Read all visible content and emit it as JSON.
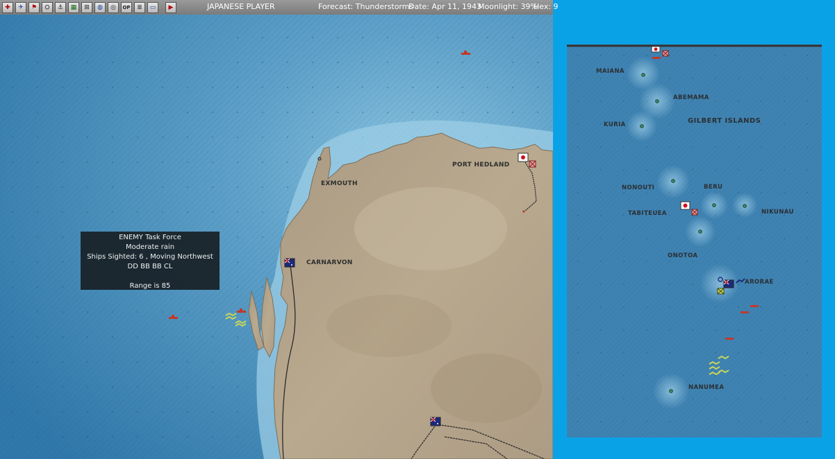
{
  "toolbar": {
    "buttons": [
      {
        "icon": "ground-unit-icon",
        "glyph": "✚"
      },
      {
        "icon": "air-unit-icon",
        "glyph": "✈"
      },
      {
        "icon": "flag-icon",
        "glyph": "⚑"
      },
      {
        "icon": "airfield-icon",
        "glyph": "⛭"
      },
      {
        "icon": "ship-icon",
        "glyph": "⚓"
      },
      {
        "icon": "map-icon",
        "glyph": "▦"
      },
      {
        "icon": "port-icon",
        "glyph": "⊞"
      },
      {
        "icon": "globe-icon",
        "glyph": "◍"
      },
      {
        "icon": "target-icon",
        "glyph": "◎"
      },
      {
        "icon": "op-icon",
        "glyph": "OP"
      },
      {
        "icon": "report-icon",
        "glyph": "≣"
      },
      {
        "icon": "message-icon",
        "glyph": "▭"
      },
      {
        "icon": "end-turn-icon",
        "glyph": "▶"
      }
    ],
    "player": "JAPANESE PLAYER",
    "forecast": "Forecast: Thunderstorms",
    "date": "Date: Apr 11, 1943",
    "moonlight": "Moonlight: 39%",
    "hex": "Hex: 9"
  },
  "main_map": {
    "labels": {
      "exmouth": "EXMOUTH",
      "port_hedland": "PORT HEDLAND",
      "carnarvon": "CARNARVON"
    },
    "tooltip": {
      "line1": "ENEMY Task Force",
      "line2": "Moderate rain",
      "line3": "Ships Sighted: 6 , Moving Northwest",
      "line4": "DD BB BB CL",
      "line5": "Range is 85"
    }
  },
  "mini_map": {
    "labels": {
      "maiana": "MAIANA",
      "abemama": "ABEMAMA",
      "kuria": "KURIA",
      "gilbert": "GILBERT ISLANDS",
      "nonouti": "NONOUTI",
      "beru": "BERU",
      "tabiteuea": "TABITEUEA",
      "nikunau": "NIKUNAU",
      "onotoa": "ONOTOA",
      "arorae": "ARORAE",
      "nanumea": "NANUMEA"
    }
  },
  "colors": {
    "ocean": "#3d86b5",
    "shallow": "#86c3e2",
    "land": "#b3a38c",
    "frame": "#0aa2e6",
    "tooltip_bg": "#182026",
    "ship_red": "#c0392b",
    "ship_yellow": "#c9d65a",
    "japanese_flag_red": "#cc1122"
  }
}
